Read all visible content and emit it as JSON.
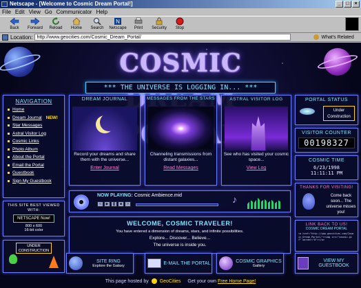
{
  "window": {
    "title": "Netscape - [Welcome to Cosmic Dream Portal!]"
  },
  "menu": [
    "File",
    "Edit",
    "View",
    "Go",
    "Communicator",
    "Help"
  ],
  "toolbar": [
    {
      "label": "Back",
      "icon": "back-arrow-icon"
    },
    {
      "label": "Forward",
      "icon": "forward-arrow-icon"
    },
    {
      "label": "Reload",
      "icon": "reload-icon"
    },
    {
      "label": "Home",
      "icon": "home-icon"
    },
    {
      "label": "Search",
      "icon": "search-icon"
    },
    {
      "label": "Netscape",
      "icon": "netscape-icon"
    },
    {
      "label": "Print",
      "icon": "print-icon"
    },
    {
      "label": "Security",
      "icon": "lock-icon"
    },
    {
      "label": "Stop",
      "icon": "stop-icon"
    }
  ],
  "location": {
    "label": "Location:",
    "url": "http://www.geocities.com/Cosmic_Dream_Portal/",
    "related": "What's Related"
  },
  "site": {
    "title": "COSMIC DREAM PORTAL",
    "tagline": "*** THE UNIVERSE IS LOGGING IN... ***",
    "nav": {
      "heading": "NAVIGATION",
      "items": [
        "Home",
        "Dream Journal",
        "Star Messages",
        "Astral Visitor Log",
        "Cosmic Links",
        "Photo Album",
        "About the Portal",
        "Email the Portal",
        "Guestbook",
        "Sign My Guestbook"
      ],
      "new_badge": "NEW!"
    },
    "best_viewed": {
      "heading": "THIS SITE BEST VIEWED WITH:",
      "product": "NETSCAPE Now!",
      "res": "800 x 600",
      "color": "16-bit color"
    },
    "under_construction": "UNDER CONSTRUCTION",
    "cards": [
      {
        "heading": "DREAM JOURNAL",
        "desc": "Record your dreams and share them with the universe...",
        "link": "Enter Journal"
      },
      {
        "heading": "MESSAGES FROM THE STARS",
        "desc": "Channeling transmissions from distant galaxies...",
        "link": "Read Messages"
      },
      {
        "heading": "ASTRAL VISITOR LOG",
        "desc": "See who has visited your cosmic space...",
        "link": "View Log"
      }
    ],
    "status": {
      "heading": "PORTAL STATUS",
      "value": "Under Construction"
    },
    "counter": {
      "heading": "VISITOR COUNTER",
      "value": "00198327"
    },
    "time": {
      "heading": "COSMIC TIME",
      "date": "6/23/1998",
      "clock": "11:11:11 PM"
    },
    "thanks": {
      "heading": "THANKS FOR VISITING!",
      "body": "Come back soon... The universe misses you!"
    },
    "player": {
      "label": "NOW PLAYING:",
      "track": "Cosmic Ambience.mid"
    },
    "welcome": {
      "heading": "WELCOME, COSMIC TRAVELER!",
      "line1": "You have entered a dimension of dreams, stars, and infinite possibilities.",
      "line2": "Explore... Discover... Believe...",
      "line3": "The universe is inside you."
    },
    "linkback": {
      "heading": "LINK BACK TO US!",
      "sub": "COSMIC DREAM PORTAL",
      "code": "<a href=\"http://www.geocities.com/Cosmic_Dream_Portal/\"><img src=\"cosmic.gif\" border=\"0\"></a>"
    },
    "bottom": [
      {
        "title": "SITE RING",
        "sub": "Explore the Galaxy"
      },
      {
        "title": "E-MAIL THE PORTAL",
        "sub": ""
      },
      {
        "title": "COSMIC GRAPHICS",
        "sub": "Gallery"
      },
      {
        "title": "VIEW MY GUESTBOOK",
        "sub": ""
      }
    ],
    "footer": {
      "prefix": "This page hosted by",
      "host": "GeoCities",
      "middle": "Get your own",
      "link": "Free Home Page!"
    }
  }
}
